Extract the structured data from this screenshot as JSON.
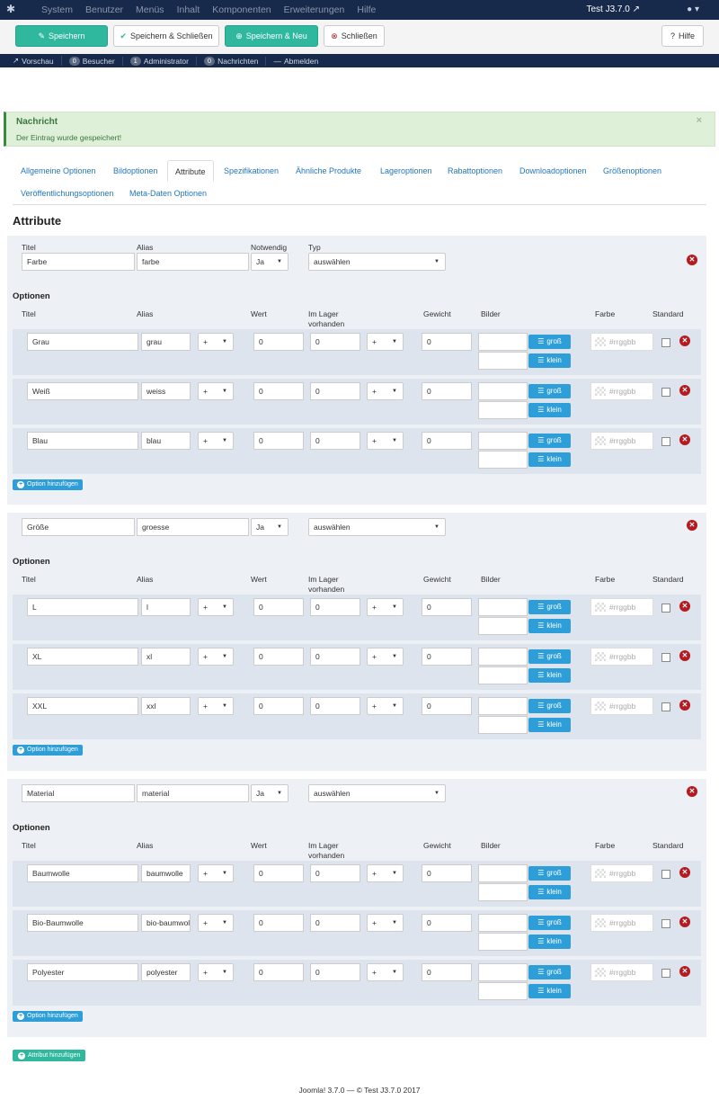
{
  "navbar": {
    "menu": [
      "System",
      "Benutzer",
      "Menüs",
      "Inhalt",
      "Komponenten",
      "Erweiterungen",
      "Hilfe"
    ],
    "site_name": "Test J3.7.0"
  },
  "toolbar": {
    "save": "Speichern",
    "save_close": "Speichern & Schließen",
    "save_new": "Speichern & Neu",
    "close": "Schließen",
    "help": "Hilfe"
  },
  "status": {
    "preview": "Vorschau",
    "visitors_count": "0",
    "visitors": "Besucher",
    "admin_count": "1",
    "admin": "Administrator",
    "messages_count": "0",
    "messages": "Nachrichten",
    "logout": "Abmelden"
  },
  "alert": {
    "heading": "Nachricht",
    "text": "Der Eintrag wurde gespeichert!",
    "close": "×"
  },
  "tabs": [
    "Allgemeine Optionen",
    "Bildoptionen",
    "Attribute",
    "Spezifikationen",
    "Ähnliche Produkte",
    "Lageroptionen",
    "Rabattoptionen",
    "Downloadoptionen",
    "Größenoptionen",
    "Veröffentlichungsoptionen",
    "Meta-Daten Optionen"
  ],
  "page_title": "Attribute",
  "header_labels": {
    "title": "Titel",
    "alias": "Alias",
    "required": "Notwendig",
    "type": "Typ"
  },
  "options_heading": "Optionen",
  "option_cols": {
    "title": "Titel",
    "alias": "Alias",
    "value": "Wert",
    "stock": "Im Lager vorhanden",
    "weight": "Gewicht",
    "images": "Bilder",
    "color": "Farbe",
    "default": "Standard"
  },
  "btn_large": "groß",
  "btn_small": "klein",
  "color_placeholder": "#rrggbb",
  "add_option": "Option hinzufügen",
  "add_attribute": "Attribut hinzufügen",
  "footer": "Joomla! 3.7.0  —  © Test J3.7.0 2017",
  "attributes": [
    {
      "title": "Farbe",
      "alias": "farbe",
      "required": "Ja",
      "type": "auswählen",
      "options": [
        {
          "title": "Grau",
          "alias": "grau",
          "op1": "+",
          "value": "0",
          "stock": "0",
          "op2": "+",
          "weight": "0"
        },
        {
          "title": "Weiß",
          "alias": "weiss",
          "op1": "+",
          "value": "0",
          "stock": "0",
          "op2": "+",
          "weight": "0"
        },
        {
          "title": "Blau",
          "alias": "blau",
          "op1": "+",
          "value": "0",
          "stock": "0",
          "op2": "+",
          "weight": "0"
        }
      ]
    },
    {
      "title": "Größe",
      "alias": "groesse",
      "required": "Ja",
      "type": "auswählen",
      "options": [
        {
          "title": "L",
          "alias": "l",
          "op1": "+",
          "value": "0",
          "stock": "0",
          "op2": "+",
          "weight": "0"
        },
        {
          "title": "XL",
          "alias": "xl",
          "op1": "+",
          "value": "0",
          "stock": "0",
          "op2": "+",
          "weight": "0"
        },
        {
          "title": "XXL",
          "alias": "xxl",
          "op1": "+",
          "value": "0",
          "stock": "0",
          "op2": "+",
          "weight": "0"
        }
      ]
    },
    {
      "title": "Material",
      "alias": "material",
      "required": "Ja",
      "type": "auswählen",
      "options": [
        {
          "title": "Baumwolle",
          "alias": "baumwolle",
          "op1": "+",
          "value": "0",
          "stock": "0",
          "op2": "+",
          "weight": "0"
        },
        {
          "title": "Bio-Baumwolle",
          "alias": "bio-baumwolle",
          "op1": "+",
          "value": "0",
          "stock": "0",
          "op2": "+",
          "weight": "0"
        },
        {
          "title": "Polyester",
          "alias": "polyester",
          "op1": "+",
          "value": "0",
          "stock": "0",
          "op2": "+",
          "weight": "0"
        }
      ]
    }
  ]
}
